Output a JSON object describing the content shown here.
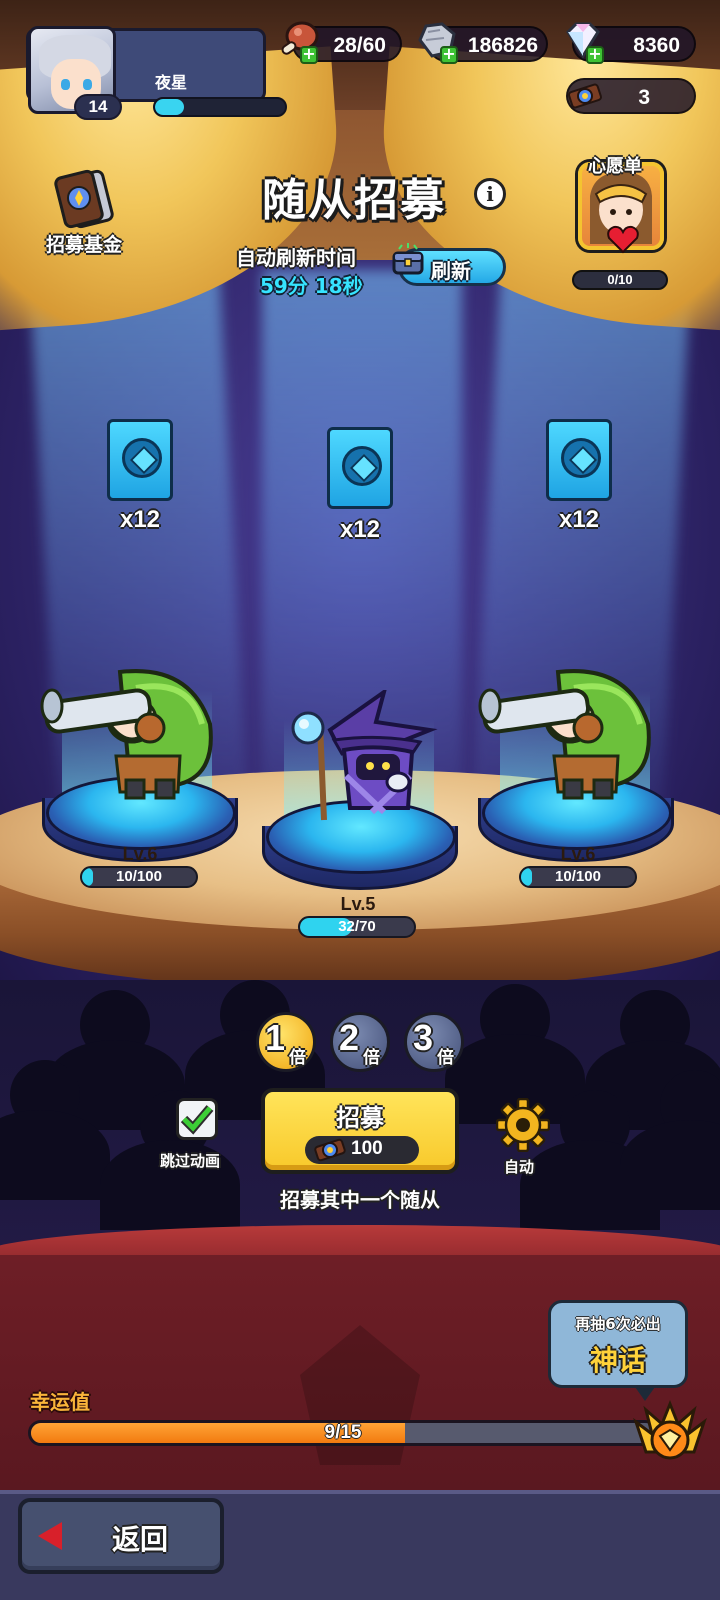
{
  "player": {
    "name": "夜星",
    "level": "14",
    "exp_ratio": 0.22
  },
  "resources": {
    "stamina": "28/60",
    "stone": "186826",
    "diamond": "8360",
    "recruit_token": "3"
  },
  "header": {
    "title": "随从招募",
    "info_symbol": "i",
    "fund_label": "招募基金",
    "refresh_title": "自动刷新时间",
    "refresh_countdown": "59分 18秒",
    "refresh_button": "刷新",
    "wishlist_title": "心愿单",
    "wishlist_progress": "0/10"
  },
  "slots": [
    {
      "card_count": "x12",
      "hero": "green-hooded-bazooka-gunner",
      "level": "Lv.6",
      "progress": "10/100",
      "ratio": 0.1
    },
    {
      "card_count": "x12",
      "hero": "purple-hat-wizard",
      "level": "Lv.5",
      "progress": "32/70",
      "ratio": 0.457
    },
    {
      "card_count": "x12",
      "hero": "green-hooded-bazooka-gunner",
      "level": "Lv.6",
      "progress": "10/100",
      "ratio": 0.1
    }
  ],
  "multipliers": [
    {
      "num": "1",
      "unit": "倍",
      "active": true
    },
    {
      "num": "2",
      "unit": "倍",
      "active": false
    },
    {
      "num": "3",
      "unit": "倍",
      "active": false
    }
  ],
  "controls": {
    "skip_label": "跳过动画",
    "skip_checked": true,
    "recruit_label": "招募",
    "recruit_cost": "100",
    "auto_label": "自动",
    "hint": "招募其中一个随从"
  },
  "luck": {
    "label": "幸运值",
    "value": "9/15",
    "ratio": 0.6,
    "bubble_line1": "再抽6次必出",
    "bubble_line2": "神话"
  },
  "footer": {
    "back_label": "返回"
  },
  "colors": {
    "accent_cyan": "#2fd3ef",
    "recruit_yellow": "#f8c92b",
    "luck_orange": "#f27a0f",
    "back_red": "#d8202a"
  },
  "icons": {
    "stamina": "meat-drumstick-icon",
    "stone": "stone-fist-icon",
    "diamond": "diamond-icon",
    "recruit_token": "recruit-token-icon",
    "fund": "recruit-fund-icon",
    "refresh": "treasure-chest-icon",
    "wishlist": "wishlist-heart-icon",
    "skip": "checkmark-icon",
    "auto": "gear-icon",
    "mythic": "mythic-crest-icon",
    "back": "back-arrow-icon"
  }
}
